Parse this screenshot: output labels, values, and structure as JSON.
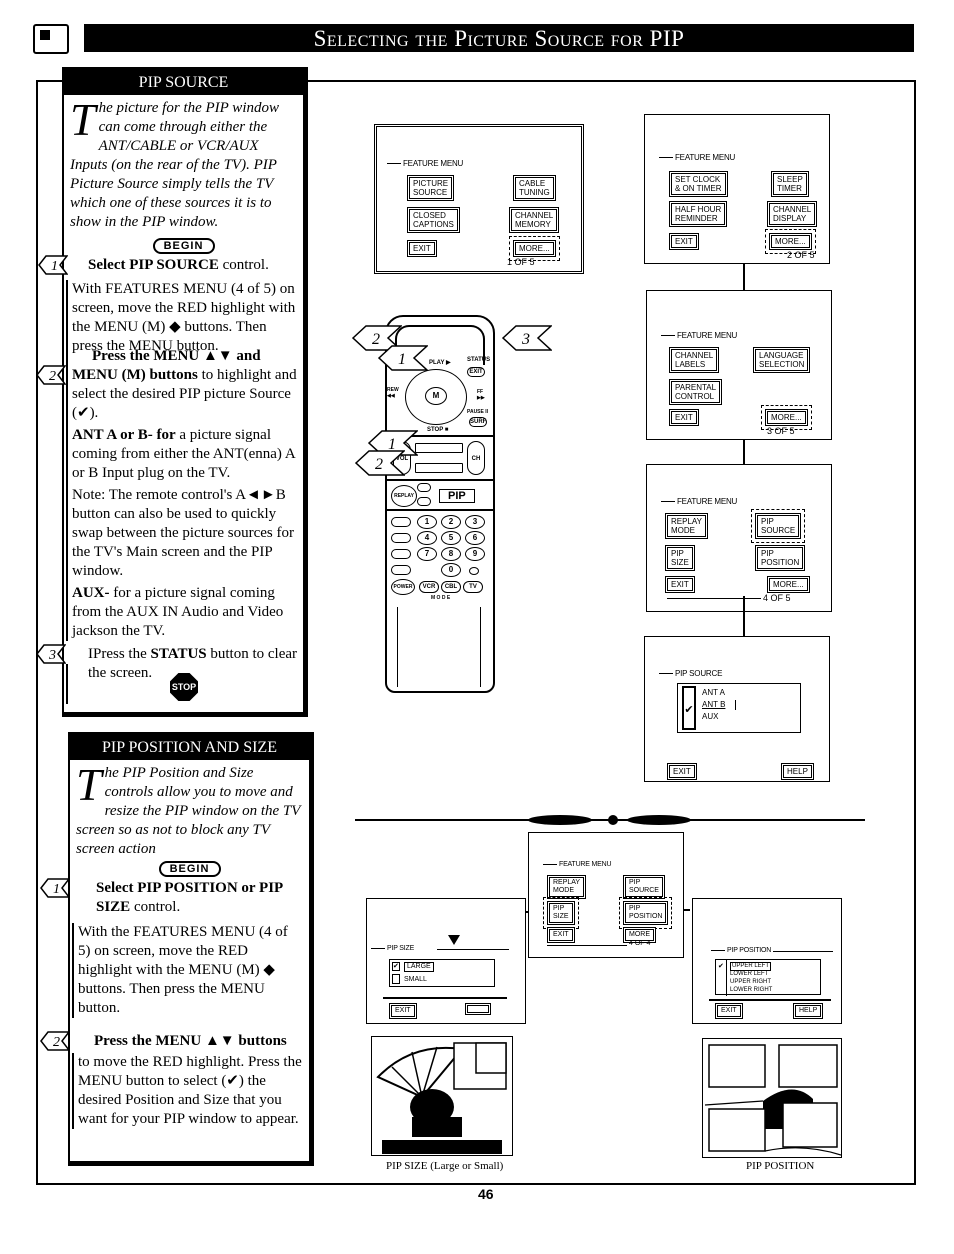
{
  "header": {
    "title": "Selecting the Picture Source for PIP",
    "icon": "tv-screen-icon"
  },
  "pip_source_panel": {
    "title": "PIP SOURCE",
    "intro_dropcap": "T",
    "intro": "he picture for the PIP window can come through either the ANT/CABLE or VCR/AUX Inputs (on the rear of the TV). PIP Picture Source simply tells the TV which one of these sources it is to show in the PIP window.",
    "begin_label": "BEGIN",
    "steps": [
      {
        "number": "1",
        "head_pre": "Select ",
        "head_bold": "PIP SOURCE",
        "head_post": " control.",
        "body": "With FEATURES MENU (4 of 5) on screen, move the RED highlight with the MENU (M) ◆ buttons. Then press the MENU button."
      },
      {
        "number": "2",
        "head_bold": "Press the MENU ▲▼ and MENU (M) buttons",
        "head_post": " to highlight and select the desired PIP picture Source (✔).",
        "ant_bold": "ANT A or B- for",
        "ant_text": " a picture signal coming from either the ANT(enna) A or B Input plug on the TV.",
        "note": "Note: The remote control's A◄►B button can also be used to quickly swap between the picture sources for the TV's Main screen and the PIP window.",
        "aux_bold": "AUX-",
        "aux_text": " for a picture signal coming from the AUX IN Audio and Video jackson the TV."
      },
      {
        "number": "3",
        "head_pre": "IPress the ",
        "head_bold": "STATUS",
        "head_post": " button to clear the screen.",
        "stop_label": "STOP"
      }
    ]
  },
  "pip_position_panel": {
    "title": "PIP POSITION AND SIZE",
    "intro_dropcap": "T",
    "intro": "he PIP Position and Size controls allow you to move and resize the PIP window on the TV screen so as not to block any TV screen action",
    "begin_label": "BEGIN",
    "steps": [
      {
        "number": "1",
        "head_bold": "Select PIP POSITION or PIP SIZE",
        "head_post": " control.",
        "body": "With the FEATURES MENU (4 of 5) on screen, move the RED highlight with the MENU (M) ◆ buttons. Then press the MENU button."
      },
      {
        "number": "2",
        "head_bold": "Press the MENU ▲▼ buttons",
        "body": "to move the RED highlight. Press the MENU button to select (✔) the desired Position and Size that you want for your PIP window to appear."
      }
    ]
  },
  "screens": {
    "menu1": {
      "title": "FEATURE MENU",
      "buttons": [
        "PICTURE\nSOURCE",
        "CABLE\nTUNING",
        "CLOSED\nCAPTIONS",
        "CHANNEL\nMEMORY",
        "EXIT",
        "MORE..."
      ],
      "pager": "1 OF 5"
    },
    "menu2": {
      "title": "FEATURE MENU",
      "buttons": [
        "SET CLOCK\n& ON TIMER",
        "SLEEP\nTIMER",
        "HALF HOUR\nREMINDER",
        "CHANNEL\nDISPLAY",
        "EXIT",
        "MORE..."
      ],
      "pager": "2 OF 5"
    },
    "menu3": {
      "title": "FEATURE MENU",
      "buttons": [
        "CHANNEL\nLABELS",
        "LANGUAGE\nSELECTION",
        "PARENTAL\nCONTROL",
        "EXIT",
        "MORE..."
      ],
      "pager": "3 OF 5"
    },
    "menu4": {
      "title": "FEATURE MENU",
      "buttons": [
        "REPLAY\nMODE",
        "PIP\nSOURCE",
        "PIP\nSIZE",
        "PIP\nPOSITION",
        "EXIT",
        "MORE..."
      ],
      "pager": "4 OF 5"
    },
    "pip_source": {
      "title": "PIP SOURCE",
      "options": [
        "ANT A",
        "ANT B",
        "AUX"
      ],
      "selected": "ANT B",
      "exit": "EXIT",
      "help": "HELP"
    },
    "menu4b": {
      "title": "FEATURE MENU",
      "buttons": [
        "REPLAY\nMODE",
        "PIP\nSOURCE",
        "PIP\nSIZE",
        "PIP\nPOSITION",
        "EXIT",
        "MORE"
      ],
      "pager": "4 OF 4"
    },
    "pip_size": {
      "title": "PIP SIZE",
      "options": [
        "LARGE",
        "SMALL"
      ],
      "selected": "LARGE",
      "exit": "EXIT"
    },
    "pip_position": {
      "title": "PIP POSITION",
      "options": [
        "UPPER LEFT",
        "LOWER LEFT",
        "UPPER RIGHT",
        "LOWER RIGHT"
      ],
      "selected": "UPPER LEFT",
      "exit": "EXIT",
      "help": "HELP"
    }
  },
  "remote": {
    "labels": {
      "play": "PLAY ▶",
      "status": "STATUS",
      "exit": "EXIT",
      "rew": "REW ◀◀",
      "ff": "FF ▶▶",
      "menu": "M",
      "pause": "PAUSE II",
      "surf": "SURF",
      "stop": "STOP ■",
      "vol": "VOL",
      "ch": "CH",
      "replay": "REPLAY",
      "pip": "PIP",
      "power": "POWER",
      "mode": "M O D E",
      "vcr": "VCR",
      "cbl": "CBL",
      "tv": "TV"
    },
    "digits": [
      "1",
      "2",
      "3",
      "4",
      "5",
      "6",
      "7",
      "8",
      "9",
      "0"
    ],
    "callouts": [
      "2",
      "1",
      "3",
      "1",
      "2"
    ]
  },
  "captions": {
    "pip_size": "PIP SIZE (Large or Small)",
    "pip_position": "PIP POSITION"
  },
  "page_number": "46"
}
